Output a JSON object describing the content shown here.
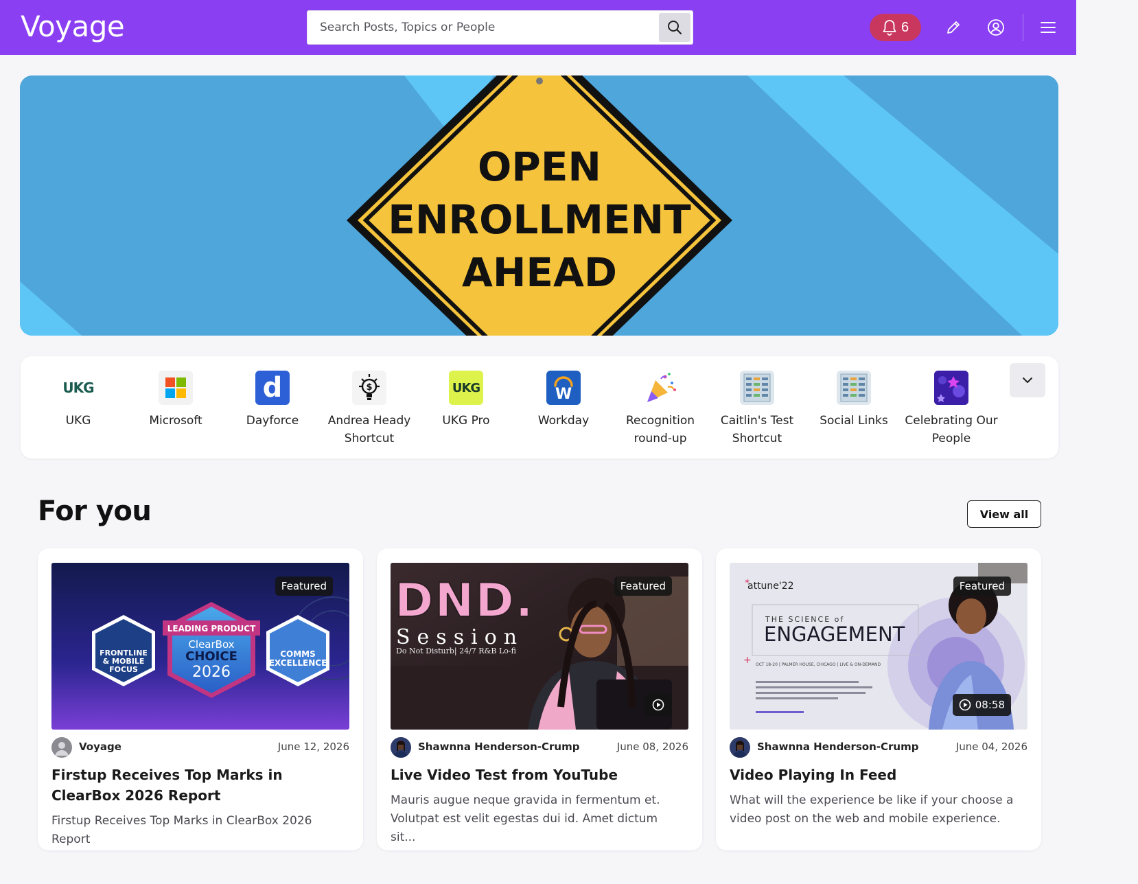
{
  "header": {
    "brand": "Voyage",
    "search_placeholder": "Search Posts, Topics or People",
    "notification_count": "6",
    "colors": {
      "bar": "#8a3ff3",
      "notification": "#c9375f"
    }
  },
  "hero": {
    "sign_lines": [
      "OPEN",
      "ENROLLMENT",
      "AHEAD"
    ]
  },
  "shortcuts": {
    "items": [
      {
        "label": "UKG",
        "icon": "ukg-logo-icon",
        "icon_text": "UKG"
      },
      {
        "label": "Microsoft",
        "icon": "microsoft-logo-icon"
      },
      {
        "label": "Dayforce",
        "icon": "dayforce-logo-icon",
        "icon_text": "d"
      },
      {
        "label": "Andrea Heady Shortcut",
        "icon": "lightbulb-dollar-icon"
      },
      {
        "label": "UKG Pro",
        "icon": "ukg-pro-logo-icon",
        "icon_text": "UKG"
      },
      {
        "label": "Workday",
        "icon": "workday-logo-icon",
        "icon_text": "W"
      },
      {
        "label": "Recognition round-up",
        "icon": "party-popper-icon"
      },
      {
        "label": "Caitlin's Test Shortcut",
        "icon": "spreadsheet-icon"
      },
      {
        "label": "Social Links",
        "icon": "spreadsheet-icon"
      },
      {
        "label": "Celebrating Our People",
        "icon": "celebration-image-icon"
      }
    ]
  },
  "for_you": {
    "title": "For you",
    "view_all": "View all",
    "cards": [
      {
        "badge": "Featured",
        "author": "Voyage",
        "date": "June 12, 2026",
        "title": "Firstup Receives Top Marks in ClearBox 2026 Report",
        "body": "Firstup Receives Top Marks in ClearBox 2026 Report",
        "thumb": {
          "left_badge": [
            "FRONTLINE",
            "& MOBILE",
            "FOCUS"
          ],
          "center_ribbon": "LEADING PRODUCT",
          "center_lines": [
            "ClearBox",
            "CHOICE",
            "2026"
          ],
          "right_badge": [
            "COMMS",
            "EXCELLENCE"
          ]
        }
      },
      {
        "badge": "Featured",
        "author": "Shawnna Henderson-Crump",
        "date": "June 08, 2026",
        "title": "Live Video Test from YouTube",
        "body": "Mauris augue neque gravida in fermentum et. Volutpat est velit egestas dui id. Amet dictum sit...",
        "thumb": {
          "big_text": "DND.",
          "sub_text": "Session",
          "tagline": "Do Not Disturb| 24/7 R&B Lo-fi"
        }
      },
      {
        "badge": "Featured",
        "duration": "08:58",
        "author": "Shawnna Henderson-Crump",
        "date": "June 04, 2026",
        "title": "Video Playing In Feed",
        "body": "What will the experience be like if your choose a video post on the web and mobile experience.",
        "thumb": {
          "brand": "attune'22",
          "kicker": "THE SCIENCE of",
          "headline": "ENGAGEMENT",
          "event_line": "OCT 18-20 | PALMER HOUSE, CHICAGO | LIVE & ON-DEMAND"
        }
      }
    ]
  }
}
